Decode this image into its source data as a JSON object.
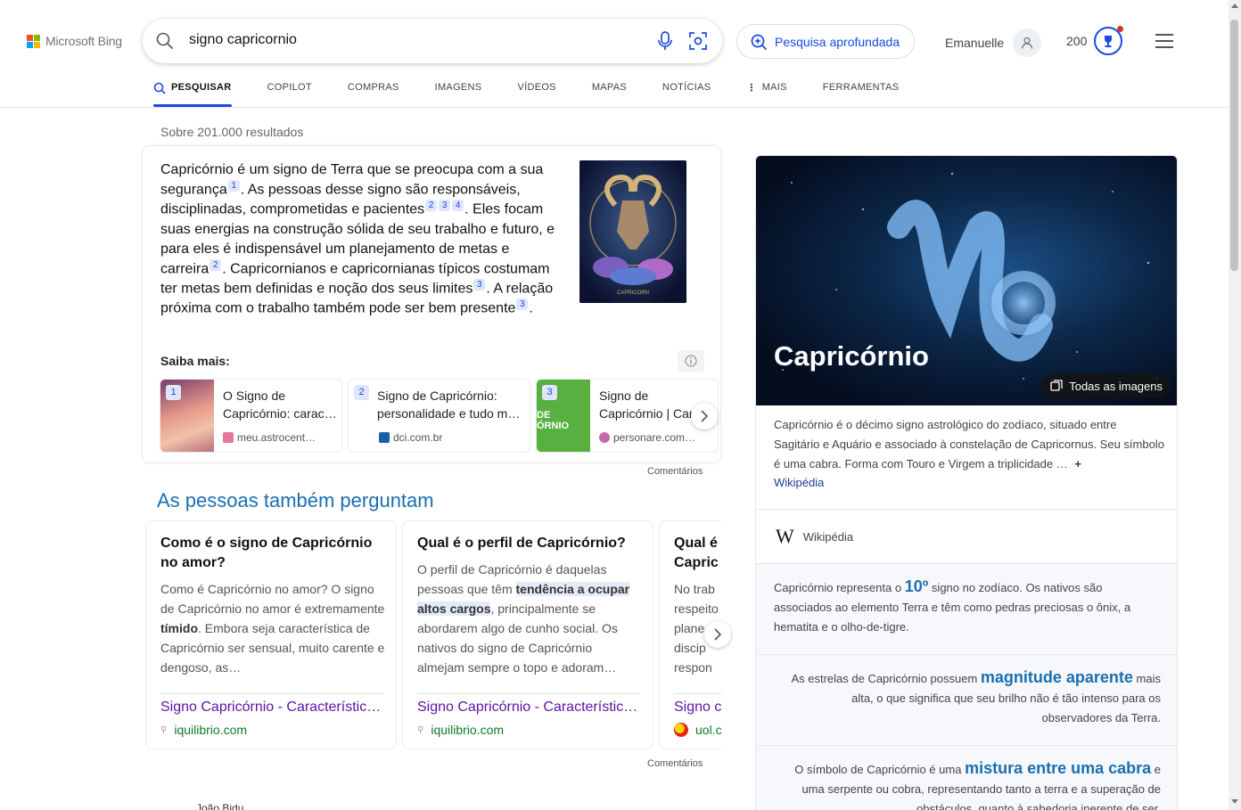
{
  "header": {
    "logo_text": "Microsoft Bing",
    "search_query": "signo capricornio",
    "deep_search_label": "Pesquisa aprofundada",
    "user_name": "Emanuelle",
    "points": "200",
    "tabs": [
      {
        "label": "PESQUISAR",
        "active": true
      },
      {
        "label": "COPILOT"
      },
      {
        "label": "COMPRAS"
      },
      {
        "label": "IMAGENS"
      },
      {
        "label": "VÍDEOS"
      },
      {
        "label": "MAPAS"
      },
      {
        "label": "NOTÍCIAS"
      },
      {
        "label": "MAIS"
      },
      {
        "label": "FERRAMENTAS"
      }
    ]
  },
  "results": {
    "count_text": "Sobre 201.000 resultados",
    "answer": {
      "p1": "Capricórnio é um signo de Terra que se preocupa com a sua segurança",
      "c1": "1",
      "p2": ". As pessoas desse signo são responsáveis, disciplinadas, comprometidas e pacientes",
      "c2a": "2",
      "c2b": "3",
      "c2c": "4",
      "p3": ". Eles focam suas energias na construção sólida de seu trabalho e futuro, e para eles é indispensável um planejamento de metas e carreira",
      "c3": "2",
      "p4": ". Capricornianos e capricornianas típicos costumam ter metas bem definidas e noção dos seus limites",
      "c4": "3",
      "p5": ". A relação próxima com o trabalho também pode ser bem presente",
      "c5": "3",
      "p6": ".",
      "image_caption": "CAPRICORN"
    },
    "saiba_mais_label": "Saiba mais:",
    "sources": [
      {
        "num": "1",
        "title": "O Signo de Capricórnio: carac…",
        "domain": "meu.astrocent…"
      },
      {
        "num": "2",
        "title": "Signo de Capricórnio: personalidade e tudo m…",
        "domain": "dci.com.br"
      },
      {
        "num": "3",
        "title": "Signo de Capricórnio | Car…",
        "domain": "personare.com…",
        "thumb_text": "DE ÓRNIO"
      }
    ],
    "feedback_label": "Comentários",
    "paa_title": "As pessoas também perguntam",
    "paa": [
      {
        "question": "Como é o signo de Capricórnio no amor?",
        "a1": "Como é Capricórnio no amor? O signo de Capricórnio no amor é extremamente ",
        "a1b": "tímido",
        "a2": ". Embora seja característica de Capricórnio ser sensual, muito carente e dengoso, as…",
        "link": "Signo Capricórnio - Característic…",
        "domain": "iquilibrio.com"
      },
      {
        "question": "Qual é o perfil de Capricórnio?",
        "a1": "O perfil de Capricórnio é daquelas pessoas que têm ",
        "a1b": "tendência a ocupar altos cargos",
        "a2": ", principalmente se abordarem algo de cunho social. Os nativos do signo de Capricórnio almejam sempre o topo e adoram…",
        "link": "Signo Capricórnio - Característic…",
        "domain": "iquilibrio.com"
      },
      {
        "question": "Qual é Capric",
        "a1": "No trab respeito plane discip respon",
        "a1b": "",
        "a2": "",
        "link": "Signo c",
        "domain": "uol.c"
      }
    ],
    "feedback_label_2": "Comentários",
    "next_result_name": "João Bidu"
  },
  "knowledge_panel": {
    "title": "Capricórnio",
    "all_images_label": "Todas as imagens",
    "description": "Capricórnio é o décimo signo astrológico do zodíaco, situado entre Sagitário e Aquário e associado à constelação de Capricornus. Seu símbolo é uma cabra. Forma com Touro e Virgem a triplicidade …",
    "expand_symbol": "+",
    "wiki_link": "Wikipédia",
    "wiki_source": "Wikipédia",
    "fact1": {
      "pre": "Capricórnio representa o ",
      "big": "10º",
      "post": " signo no zodíaco. Os nativos são associados ao elemento Terra e têm como pedras preciosas o ônix, a hematita e o olho-de-tigre."
    },
    "fact2": {
      "pre": "As estrelas de Capricórnio possuem ",
      "big": "magnitude aparente",
      "post": " mais alta, o que significa que seu brilho não é tão intenso para os observadores da Terra."
    },
    "fact3": {
      "pre": "O símbolo de Capricórnio é uma ",
      "big": "mistura entre uma cabra",
      "post": " e uma serpente ou cobra, representando tanto a terra e a superação de obstáculos, quanto à sabedoria inerente de ser."
    }
  },
  "colors": {
    "accent": "#174ae4",
    "link_visited": "#5f12a6",
    "domain_green": "#0d7a2a",
    "heading_blue": "#1a6fb0"
  }
}
